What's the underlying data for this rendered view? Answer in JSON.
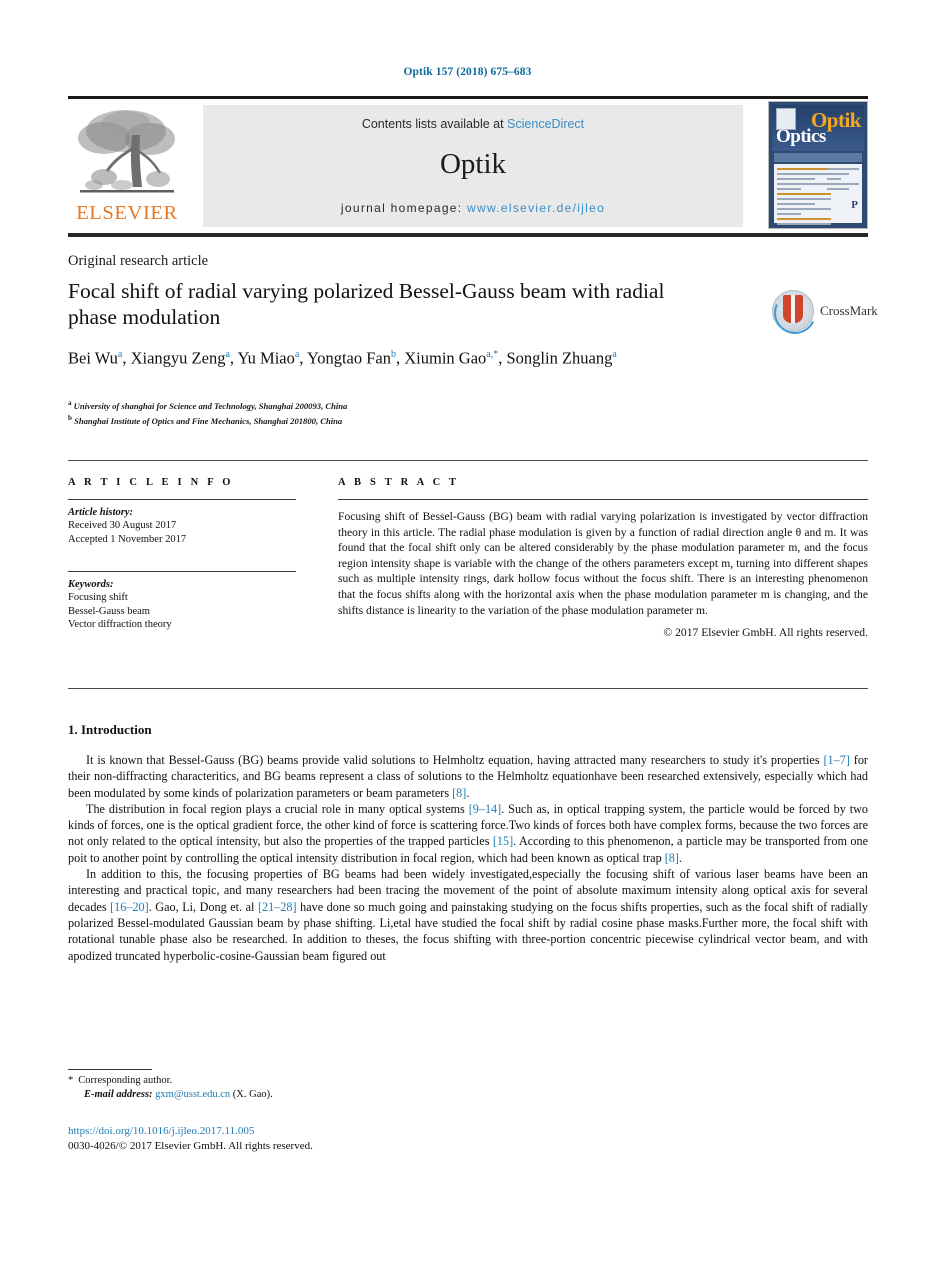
{
  "running_head": "Optik 157 (2018) 675–683",
  "masthead": {
    "publisher_name": "ELSEVIER",
    "contents_prefix": "Contents lists available at ",
    "contents_link": "ScienceDirect",
    "journal_title": "Optik",
    "homepage_prefix": "journal homepage: ",
    "homepage_url": "www.elsevier.de/ijleo",
    "cover": {
      "title_top": "Optik",
      "title_bottom": "Optics",
      "page_mark": "P"
    },
    "colors": {
      "elsevier_orange": "#E87722",
      "link_blue": "#3a8dc4",
      "band_grey": "#e9e9e9",
      "cover_blue": "#2e4a72"
    }
  },
  "article": {
    "type": "Original research article",
    "title": "Focal shift of radial varying polarized Bessel-Gauss beam with radial phase modulation",
    "crossmark_label": "CrossMark",
    "authors_html": "Bei Wu<sup>a</sup>, Xiangyu Zeng<sup>a</sup>, Yu Miao<sup>a</sup>, Yongtao Fan<sup>b</sup>, Xiumin Gao<sup>a,*</sup>, Songlin Zhuang<sup>a</sup>",
    "affiliations": [
      {
        "marker": "a",
        "text": "University of shanghai for Science and Technology, Shanghai 200093, China"
      },
      {
        "marker": "b",
        "text": "Shanghai Institute of Optics and Fine Mechanics, Shanghai 201800, China"
      }
    ]
  },
  "article_info": {
    "heading": "A R T I C L E   I N F O",
    "history_label": "Article history:",
    "history": [
      "Received 30 August 2017",
      "Accepted 1 November 2017"
    ],
    "keywords_label": "Keywords:",
    "keywords": [
      "Focusing shift",
      "Bessel-Gauss beam",
      "Vector diffraction theory"
    ]
  },
  "abstract": {
    "heading": "A B S T R A C T",
    "text": "Focusing shift of Bessel-Gauss (BG) beam with radial varying polarization is investigated by vector diffraction theory in this article. The radial phase modulation is given by a function of radial direction angle θ and m. It was found that the focal shift only can be altered considerably by the phase modulation parameter m, and the focus region intensity shape is variable with the change of the others parameters except m, turning into different shapes such as multiple intensity rings, dark hollow focus without the focus shift. There is an interesting phenomenon that the focus shifts along with the horizontal axis when the phase modulation parameter m is changing, and the shifts distance is linearity to the variation of the phase modulation parameter m.",
    "copyright": "© 2017 Elsevier GmbH. All rights reserved."
  },
  "introduction": {
    "heading": "1. Introduction",
    "paragraphs": [
      "It is known that Bessel-Gauss (BG) beams provide valid solutions to Helmholtz equation, having attracted many researchers to study it's properties [1–7] for their non-diffracting characteritics, and BG beams represent a class of solutions to the Helmholtz equationhave been researched extensively, especially which had been modulated by some kinds of polarization parameters or beam parameters [8].",
      "The distribution in focal region plays a crucial role in many optical systems [9–14]. Such as, in optical trapping system, the particle would be forced by two kinds of forces, one is the optical gradient force, the other kind of force is scattering force.Two kinds of forces both have complex forms, because the two forces are not only related to the optical intensity, but also the properties of the trapped particles [15]. According to this phenomenon, a particle may be transported from one poit to another point by controlling the optical intensity distribution in focal region, which had been known as optical trap [8].",
      "In addition to this, the focusing properties of BG beams had been widely investigated,especially the focusing shift of various laser beams have been an interesting and practical topic, and many researchers had been tracing the movement of the point of absolute maximum intensity along optical axis for several decades [16–20]. Gao, Li, Dong et. al [21–28] have done so much going and painstaking studying on the focus shifts properties, such as the focal shift of radially polarized Bessel-modulated Gaussian beam by phase shifting. Li,etal have studied the focal shift by radial cosine phase masks.Further more, the focal shift with rotational tunable phase also be researched. In addition to theses, the focus shifting with three-portion concentric piecewise cylindrical vector beam, and with apodized truncated hyperbolic-cosine-Gaussian beam figured out"
    ]
  },
  "footer": {
    "corresponding_marker": "*",
    "corresponding_text": "Corresponding author.",
    "email_label": "E-mail address:",
    "email": "gxm@usst.edu.cn",
    "email_owner": "(X. Gao).",
    "doi": "https://doi.org/10.1016/j.ijleo.2017.11.005",
    "issn_copyright": "0030-4026/© 2017 Elsevier GmbH. All rights reserved."
  }
}
